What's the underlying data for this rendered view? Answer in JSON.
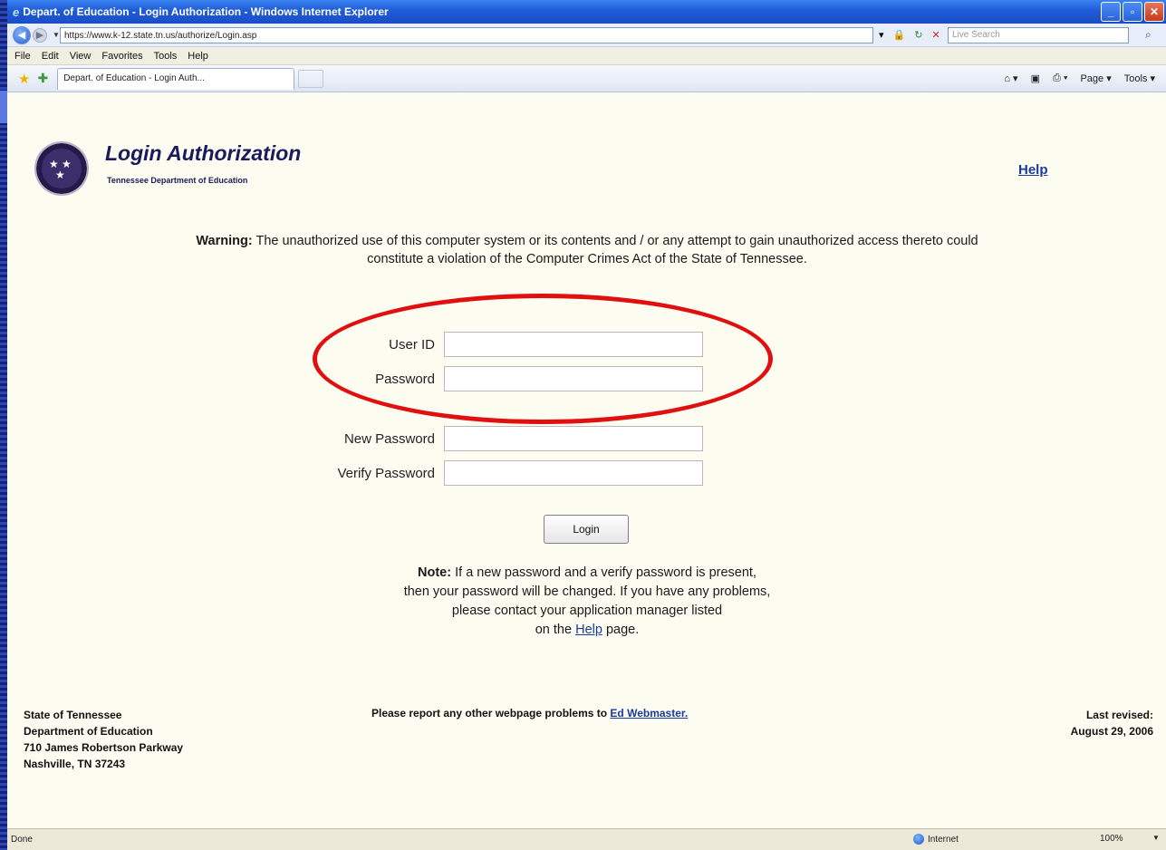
{
  "window": {
    "title": "Depart. of Education - Login Authorization - Windows Internet Explorer"
  },
  "address": {
    "url": "https://www.k-12.state.tn.us/authorize/Login.asp",
    "search_placeholder": "Live Search"
  },
  "menu": [
    "File",
    "Edit",
    "View",
    "Favorites",
    "Tools",
    "Help"
  ],
  "tab": {
    "label": "Depart. of Education - Login Auth..."
  },
  "commands": {
    "page": "Page ▾",
    "tools": "Tools ▾"
  },
  "header": {
    "title": "Login Authorization",
    "subtitle": "Tennessee Department of Education",
    "help": "Help"
  },
  "warning": {
    "label": "Warning:",
    "text": "The unauthorized use of this computer system or its contents and / or any attempt to gain unauthorized access thereto could constitute a violation of the Computer Crimes Act of the State of Tennessee."
  },
  "form": {
    "user_id_label": "User ID",
    "password_label": "Password",
    "new_password_label": "New Password",
    "verify_password_label": "Verify Password",
    "login_button": "Login"
  },
  "note": {
    "label": "Note:",
    "line1": "If a new password and a verify password is present,",
    "line2": "then your password will be changed. If you have any problems,",
    "line3": "please contact your application manager listed",
    "line4_prefix": "on the",
    "line4_link": "Help",
    "line4_suffix": "page."
  },
  "footer": {
    "address_line1": "State of Tennessee",
    "address_line2": "Department of Education",
    "address_line3": "710 James Robertson Parkway",
    "address_line4": "Nashville, TN 37243",
    "report_text": "Please report any other webpage problems to",
    "report_link": "Ed Webmaster.",
    "revised_label": "Last revised:",
    "revised_date": "August 29, 2006"
  },
  "status": {
    "text": "Done",
    "zone": "Internet",
    "zoom": "100%"
  },
  "colors": {
    "slide_background": "#1a2a8c",
    "page_background": "#fdfcf0",
    "highlight": "#e01010",
    "title_color": "#1a1a5e",
    "link_color": "#1a3a9c"
  }
}
